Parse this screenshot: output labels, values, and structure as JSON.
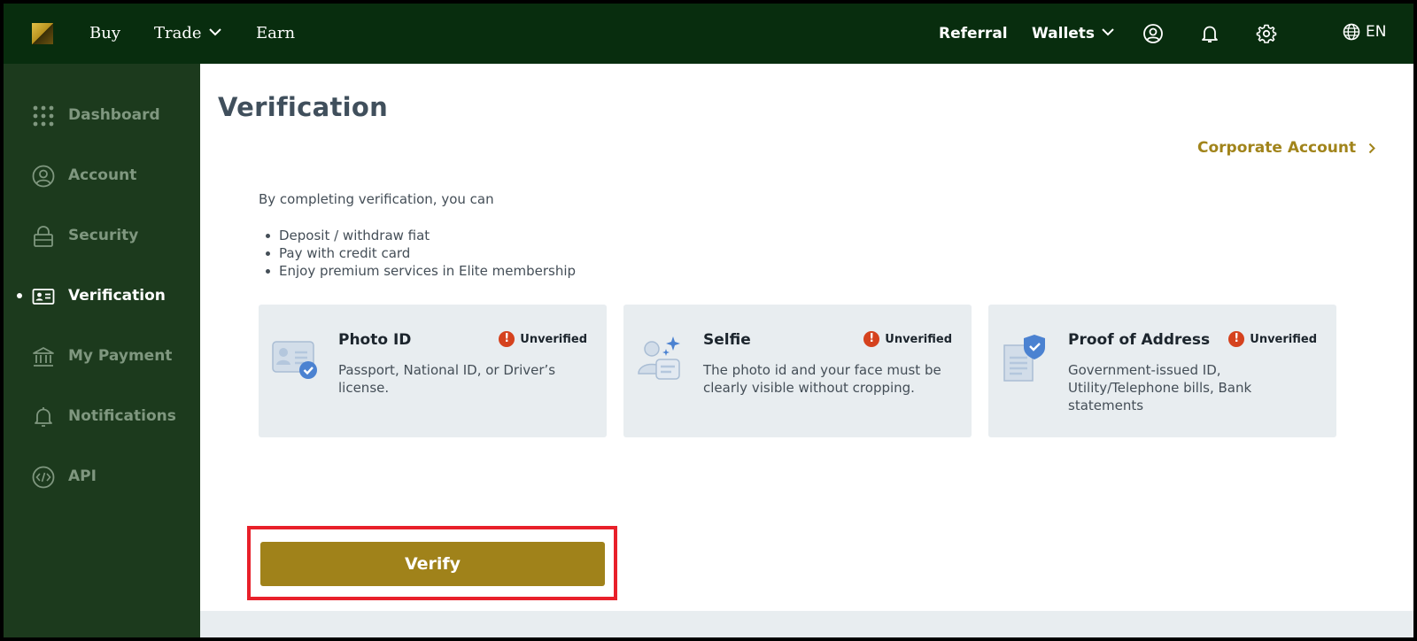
{
  "topnav": {
    "logo_name": "brand-logo",
    "links": {
      "buy": "Buy",
      "trade": "Trade",
      "earn": "Earn"
    },
    "right": {
      "referral": "Referral",
      "wallets": "Wallets",
      "language": "EN"
    },
    "icons": [
      "user-icon",
      "bell-icon",
      "gear-icon",
      "globe-icon"
    ]
  },
  "sidebar": {
    "items": [
      {
        "label": "Dashboard",
        "icon": "grid-dots-icon",
        "active": false
      },
      {
        "label": "Account",
        "icon": "user-circle-icon",
        "active": false
      },
      {
        "label": "Security",
        "icon": "lock-icon",
        "active": false
      },
      {
        "label": "Verification",
        "icon": "id-card-icon",
        "active": true
      },
      {
        "label": "My Payment",
        "icon": "bank-icon",
        "active": false
      },
      {
        "label": "Notifications",
        "icon": "bell-icon",
        "active": false
      },
      {
        "label": "API",
        "icon": "code-icon",
        "active": false
      }
    ]
  },
  "main": {
    "title": "Verification",
    "corporate_link": "Corporate Account",
    "intro": "By completing verification, you can",
    "benefits": [
      "Deposit / withdraw fiat",
      "Pay with credit card",
      "Enjoy premium services in Elite membership"
    ],
    "cards": [
      {
        "title": "Photo ID",
        "status": "Unverified",
        "description": "Passport, National ID, or Driver’s license.",
        "icon": "id-card-check-icon"
      },
      {
        "title": "Selfie",
        "status": "Unverified",
        "description": "The photo id and your face must be clearly visible without cropping.",
        "icon": "selfie-sparkle-icon"
      },
      {
        "title": "Proof of Address",
        "status": "Unverified",
        "description": "Government-issued ID, Utility/Telephone bills, Bank statements",
        "icon": "document-shield-icon"
      }
    ],
    "verify_button": "Verify"
  },
  "colors": {
    "topnav_bg": "#082d0e",
    "sidebar_bg": "#1c3a1d",
    "accent_gold": "#a0821a",
    "status_red": "#d5421e",
    "highlight_red": "#e8202a"
  }
}
